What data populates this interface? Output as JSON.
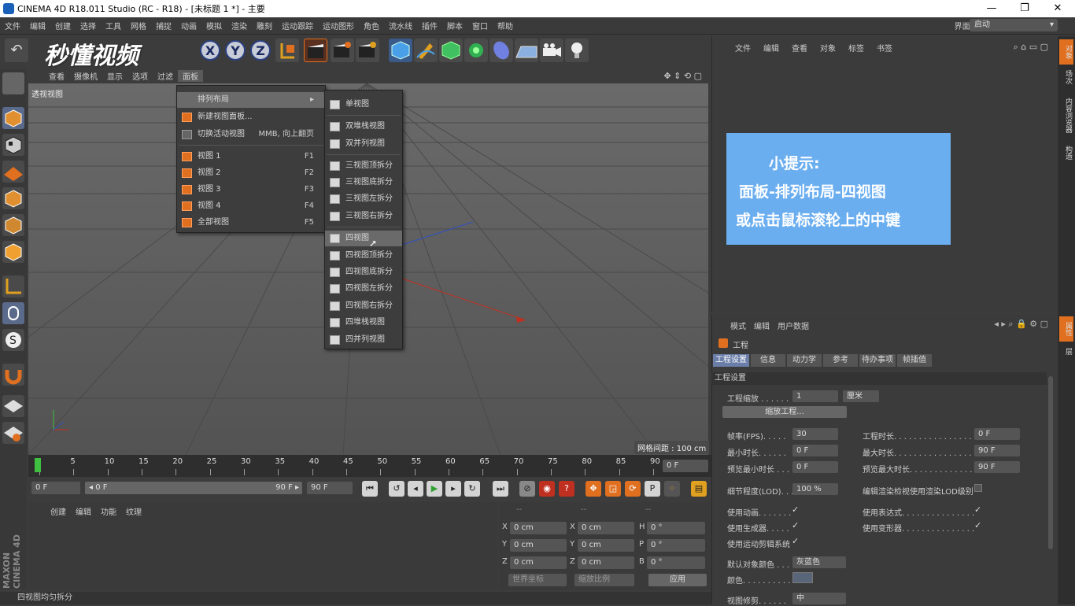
{
  "window": {
    "title": "CINEMA 4D R18.011 Studio (RC - R18) - [未标题 1 *] - 主要"
  },
  "menubar": [
    "文件",
    "编辑",
    "创建",
    "选择",
    "工具",
    "网格",
    "捕捉",
    "动画",
    "模拟",
    "渲染",
    "雕刻",
    "运动跟踪",
    "运动图形",
    "角色",
    "流水线",
    "插件",
    "脚本",
    "窗口",
    "帮助"
  ],
  "layout": {
    "label": "界面:",
    "value": "启动"
  },
  "logo": {
    "text": "秒懂视频"
  },
  "axes": [
    "X",
    "Y",
    "Z"
  ],
  "viewport_menu": [
    "查看",
    "摄像机",
    "显示",
    "选项",
    "过滤",
    "面板"
  ],
  "viewport": {
    "label": "透视视图",
    "grid_spacing": "网格间距 : 100 cm"
  },
  "panel_menu": {
    "items": [
      {
        "label": "排列布局",
        "icon": "none",
        "shortcut": "▸"
      },
      {
        "label": "新建视图面板...",
        "icon": "brick-icon",
        "shortcut": ""
      },
      {
        "label": "切换活动视图",
        "icon": "toggle-icon",
        "shortcut": "MMB, 向上翻页"
      },
      {
        "label": "视图 1",
        "icon": "view-icon",
        "shortcut": "F1"
      },
      {
        "label": "视图 2",
        "icon": "view-icon",
        "shortcut": "F2"
      },
      {
        "label": "视图 3",
        "icon": "view-icon",
        "shortcut": "F3"
      },
      {
        "label": "视图 4",
        "icon": "view-icon",
        "shortcut": "F4"
      },
      {
        "label": "全部视图",
        "icon": "view-icon",
        "shortcut": "F5"
      }
    ]
  },
  "layout_submenu": [
    "单视图",
    "双堆栈视图",
    "双并列视图",
    "三视图顶拆分",
    "三视图底拆分",
    "三视图左拆分",
    "三视图右拆分",
    "四视图",
    "四视图顶拆分",
    "四视图底拆分",
    "四视图左拆分",
    "四视图右拆分",
    "四堆栈视图",
    "四并列视图"
  ],
  "highlighted_item": "四视图",
  "timeline": {
    "ticks": [
      "0",
      "5",
      "10",
      "15",
      "20",
      "25",
      "30",
      "35",
      "40",
      "45",
      "50",
      "55",
      "60",
      "65",
      "70",
      "75",
      "80",
      "85",
      "90"
    ],
    "current": "0 F"
  },
  "playbar": {
    "start": "0 F",
    "range_start": "◂ 0 F",
    "range_end": "90 F ▸",
    "end": "90 F"
  },
  "material_menu": [
    "创建",
    "编辑",
    "功能",
    "纹理"
  ],
  "coords": {
    "rows": [
      {
        "a": "X",
        "av": "0 cm",
        "b": "X",
        "bv": "0 cm",
        "c": "H",
        "cv": "0 °"
      },
      {
        "a": "Y",
        "av": "0 cm",
        "b": "Y",
        "bv": "0 cm",
        "c": "P",
        "cv": "0 °"
      },
      {
        "a": "Z",
        "av": "0 cm",
        "b": "Z",
        "bv": "0 cm",
        "c": "B",
        "cv": "0 °"
      }
    ],
    "world": "世界坐标",
    "scale": "缩放比例",
    "apply": "应用",
    "dashes": "--"
  },
  "status": "四视图均匀拆分",
  "object_menu": [
    "文件",
    "编辑",
    "查看",
    "对象",
    "标签",
    "书签"
  ],
  "tip": {
    "line1": "小提示:",
    "line2": "面板-排列布局-四视图",
    "line3": "或点击鼠标滚轮上的中键"
  },
  "attr_menu": [
    "模式",
    "编辑",
    "用户数据"
  ],
  "attr": {
    "object": "工程",
    "tabs": [
      "工程设置",
      "信息",
      "动力学",
      "参考",
      "待办事项",
      "帧插值"
    ],
    "section": "工程设置",
    "scale_label": "工程缩放 . . . . . .",
    "scale_value": "1",
    "scale_unit": "厘米",
    "scale_button": "缩放工程...",
    "fps_label": "帧率(FPS). . . . .",
    "fps_value": "30",
    "project_time_label": "工程时长. . . . . . . . . . . . . . . .",
    "project_time_value": "0 F",
    "min_time_label": "最小时长. . . . . .",
    "min_time_value": "0 F",
    "max_time_label": "最大时长. . . . . . . . . . . . . . . .",
    "max_time_value": "90 F",
    "preview_min_label": "预览最小时长 . . .",
    "preview_min_value": "0 F",
    "preview_max_label": "预览最大时长. . . . . . . . . . . . .",
    "preview_max_value": "90 F",
    "lod_label": "细节程度(LOD). . .",
    "lod_value": "100 %",
    "lod_render_label": "编辑渲染检视使用渲染LOD级别",
    "use_anim": "使用动画. . . . . . .",
    "use_expr": "使用表达式. . . . . . . . . . . . . . .",
    "use_gen": "使用生成器. . . . .",
    "use_deform": "使用变形器. . . . . . . . . . . . . . .",
    "use_motion": "使用运动剪辑系统",
    "default_color_label": "默认对象颜色 . . .",
    "default_color_value": "灰蓝色",
    "color_label": "颜色. . . . . . . . . .",
    "view_clip_label": "视图修剪. . . . . .",
    "view_clip_value": "中",
    "check": "✓"
  },
  "right_tabs": [
    "对象",
    "场次",
    "内容浏览器",
    "构造"
  ],
  "right_tabs_bottom": [
    "属性",
    "层"
  ]
}
